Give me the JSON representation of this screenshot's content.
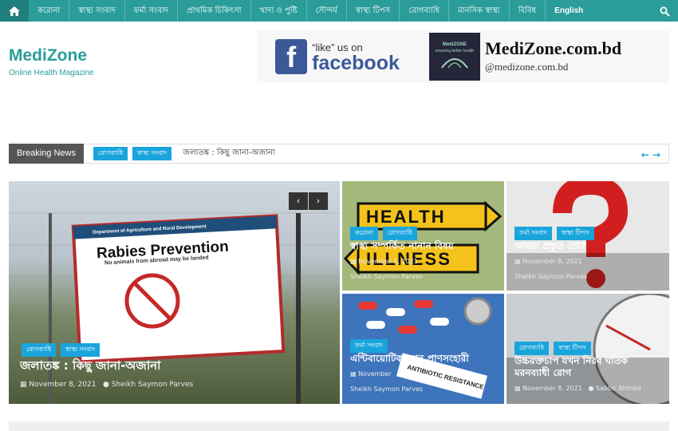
{
  "nav": {
    "items": [
      "করোনা",
      "স্বাস্থ্য সংবাদ",
      "ফর্মা সংবাদ",
      "প্রাথমিক চিকিৎসা",
      "খাদ্য ও পুষ্টি",
      "সৌন্দর্য",
      "স্বাস্থ্য টিপস",
      "রোগব্যাধি",
      "মানসিক স্বাস্থ্য",
      "বিবিধ",
      "English"
    ]
  },
  "site": {
    "title": "MediZone",
    "tagline": "Online Health Magazine"
  },
  "banner": {
    "like": "“like” us on",
    "facebook": "facebook",
    "brand": "MediZone.com.bd",
    "handle": "@medizone.com.bd",
    "badge_line1": "MediZONE",
    "badge_line2": "ensuring better health"
  },
  "breaking": {
    "label": "Breaking News",
    "tags": [
      "রোগব্যাধি",
      "স্বাস্থ্য সংবাদ"
    ],
    "headline": "জলাতঙ্ক : কিছু জানা-অজানা"
  },
  "sign": {
    "dept": "Department of Agriculture and Rural Development",
    "title": "Rabies Prevention",
    "sub": "No animals from abroad may be landed"
  },
  "cards": {
    "main": {
      "tags": [
        "রোগব্যাধি",
        "স্বাস্থ্য সংবাদ"
      ],
      "title": "জলাতঙ্ক : কিছু জানা-অজানা",
      "date": "November 8, 2021",
      "author": "Sheikh Saymon Parves"
    },
    "c1": {
      "tags": [
        "করোনা",
        "রোগব্যাধি"
      ],
      "title": "স্বাস্থ্য সম্পর্কিত নানান বিষয়",
      "date": "November 8, 2021",
      "author": "Sheikh Saymon Parves",
      "sign1": "HEALTH",
      "sign2": "ILLNESS"
    },
    "c2": {
      "tags": [
        "ফর্মা সংবাদ",
        "স্বাস্থ্য টিপস"
      ],
      "title": "আমরা প্রস্তুত তো?",
      "date": "November 8, 2021",
      "author": "Sheikh Saymon Parves"
    },
    "c3": {
      "tags": [
        "ফর্মা সংবাদ"
      ],
      "title": "এন্টিবায়োটিক যখন প্রাণসংহারী",
      "date": "November",
      "author": "Sheikh Saymon Parves",
      "label": "ANTIBIOTIC RESISTANCE"
    },
    "c4": {
      "tags": [
        "রোগব্যাধি",
        "স্বাস্থ্য টিপস"
      ],
      "title": "উচ্চরক্তচাপ যখন নিরব ঘাতক মরনব্যাধী রোগ",
      "date": "November 8, 2021",
      "author": "Sabbir Ahmed"
    }
  },
  "colors": {
    "accent": "#2a9d9b",
    "tag": "#1aa4dc",
    "facebook": "#3b5998"
  }
}
